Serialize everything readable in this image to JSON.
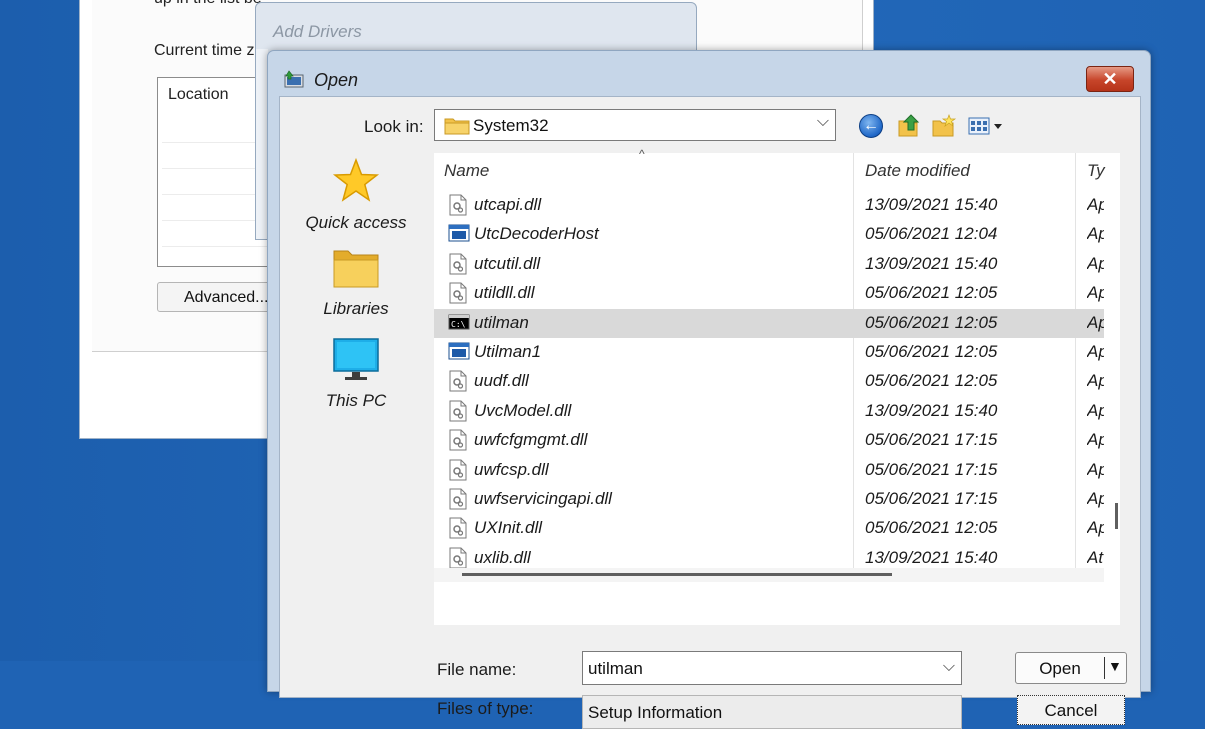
{
  "background_window": {
    "top_text": "up in the list be",
    "current_tz_label": "Current time zo",
    "list_header": "Location",
    "advanced_label": "Advanced..."
  },
  "add_drivers": {
    "title": "Add Drivers"
  },
  "open_dialog": {
    "title": "Open",
    "close_symbol": "✕",
    "look_in": {
      "label": "Look in:",
      "value": "System32",
      "arrow": "⌵"
    },
    "toolbar": {
      "back_icon": "back-arrow-icon",
      "back_symbol": "←",
      "up_icon": "up-folder-icon",
      "new_folder_icon": "new-folder-icon",
      "view_icon": "view-menu-icon"
    },
    "places": [
      {
        "label": "Quick access",
        "icon": "star-icon"
      },
      {
        "label": "Libraries",
        "icon": "libraries-folder-icon"
      },
      {
        "label": "This PC",
        "icon": "monitor-icon"
      }
    ],
    "columns": {
      "sort_arrow": "^",
      "name": "Name",
      "date": "Date modified",
      "type": "Ty"
    },
    "files": [
      {
        "name": "utcapi.dll",
        "date": "13/09/2021 15:40",
        "type": "Ap",
        "icon": "dll-file-icon"
      },
      {
        "name": "UtcDecoderHost",
        "date": "05/06/2021 12:04",
        "type": "Ap",
        "icon": "exe-window-icon"
      },
      {
        "name": "utcutil.dll",
        "date": "13/09/2021 15:40",
        "type": "Ap",
        "icon": "dll-file-icon"
      },
      {
        "name": "utildll.dll",
        "date": "05/06/2021 12:05",
        "type": "Ap",
        "icon": "dll-file-icon"
      },
      {
        "name": "utilman",
        "date": "05/06/2021 12:05",
        "type": "Ap",
        "icon": "console-exe-icon",
        "selected": true
      },
      {
        "name": "Utilman1",
        "date": "05/06/2021 12:05",
        "type": "Ap",
        "icon": "exe-window-icon"
      },
      {
        "name": "uudf.dll",
        "date": "05/06/2021 12:05",
        "type": "Ap",
        "icon": "dll-file-icon"
      },
      {
        "name": "UvcModel.dll",
        "date": "13/09/2021 15:40",
        "type": "Ap",
        "icon": "dll-file-icon"
      },
      {
        "name": "uwfcfgmgmt.dll",
        "date": "05/06/2021 17:15",
        "type": "Ap",
        "icon": "dll-file-icon"
      },
      {
        "name": "uwfcsp.dll",
        "date": "05/06/2021 17:15",
        "type": "Ap",
        "icon": "dll-file-icon"
      },
      {
        "name": "uwfservicingapi.dll",
        "date": "05/06/2021 17:15",
        "type": "Ap",
        "icon": "dll-file-icon"
      },
      {
        "name": "UXInit.dll",
        "date": "05/06/2021 12:05",
        "type": "Ap",
        "icon": "dll-file-icon"
      },
      {
        "name": "uxlib.dll",
        "date": "13/09/2021 15:40",
        "type": "At",
        "icon": "dll-file-icon"
      }
    ],
    "file_name": {
      "label": "File name:",
      "value": "utilman",
      "arrow": "⌵"
    },
    "file_type": {
      "label": "Files of type:",
      "value": "Setup Information"
    },
    "buttons": {
      "open_label": "Open",
      "open_arrow": "▼",
      "cancel_label": "Cancel"
    }
  }
}
